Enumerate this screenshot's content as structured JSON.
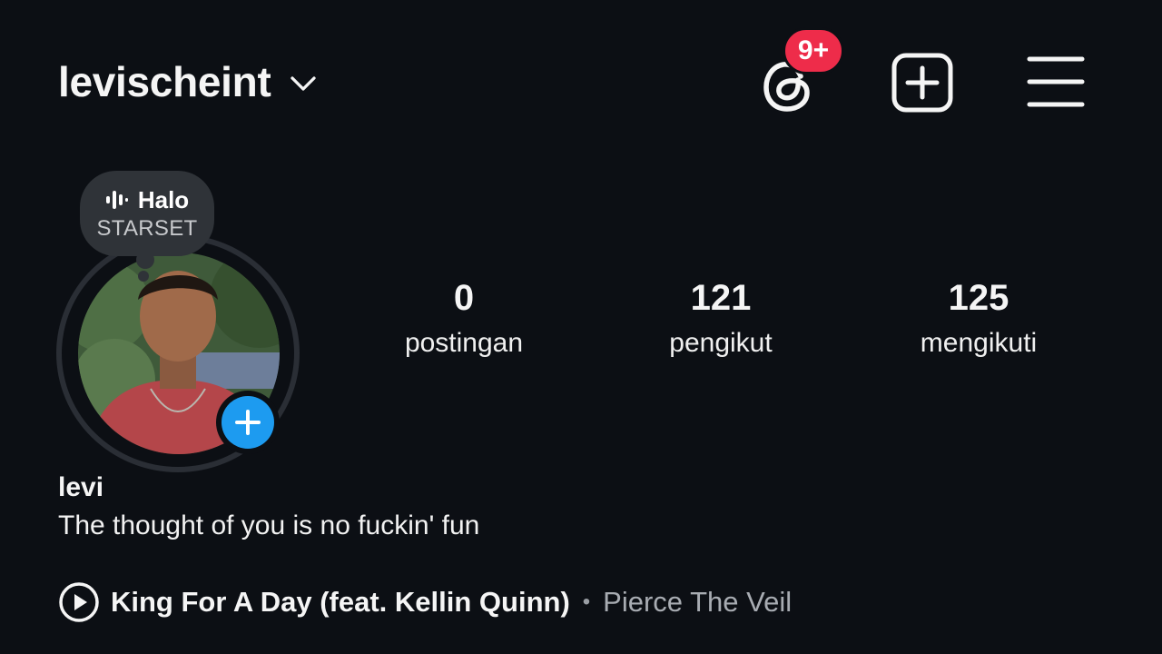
{
  "header": {
    "username": "levischeint",
    "threads_badge": "9+"
  },
  "note": {
    "title": "Halo",
    "subtitle": "STARSET"
  },
  "stats": [
    {
      "value": "0",
      "label": "postingan"
    },
    {
      "value": "121",
      "label": "pengikut"
    },
    {
      "value": "125",
      "label": "mengikuti"
    }
  ],
  "profile": {
    "display_name": "levi",
    "bio": "The thought of you is no fuckin' fun"
  },
  "music": {
    "song": "King For A Day (feat. Kellin Quinn)",
    "separator": "•",
    "artist": "Pierce The Veil"
  },
  "colors": {
    "background": "#0c0f14",
    "badge": "#ee2c4a",
    "add_story": "#1d9bf0",
    "note_bubble": "#2f3338"
  }
}
